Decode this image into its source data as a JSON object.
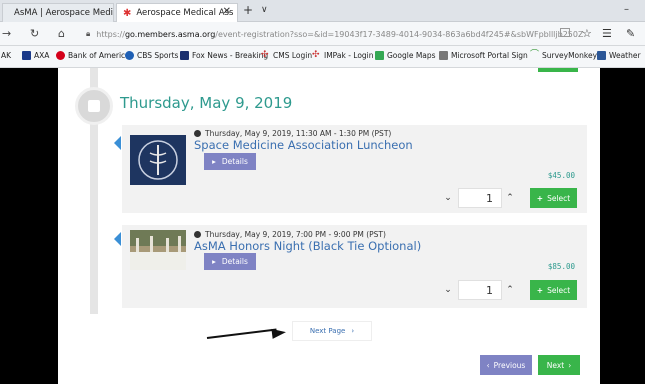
{
  "browser": {
    "tabs": [
      {
        "label": "AsMA | Aerospace Medical"
      },
      {
        "label": "Aerospace Medical Ass"
      }
    ],
    "url_prefix": "https://",
    "url_domain": "go.members.asma.org",
    "url_path": "/event-registration?sso=&id=19043f17-3489-4014-9034-863a6bd4f245#&sbWFpbllljb250ZW50IGN0bDA",
    "favorites": [
      "AK",
      "AXA",
      "Bank of America",
      "CBS Sports",
      "Fox News - Breaking",
      "CMS Login",
      "IMPak - Login",
      "Google Maps",
      "Microsoft Portal Sign",
      "SurveyMonkey",
      "Weather"
    ]
  },
  "day": {
    "title": "Thursday, May 9, 2019"
  },
  "events": [
    {
      "time": "Thursday, May 9, 2019, 11:30 AM - 1:30 PM (PST)",
      "name": "Space Medicine Association Luncheon",
      "details_label": "Details",
      "price": "$45.00",
      "qty": "1",
      "select_label": "Select"
    },
    {
      "time": "Thursday, May 9, 2019, 7:00 PM - 9:00 PM (PST)",
      "name": "AsMA Honors Night (Black Tie Optional)",
      "details_label": "Details",
      "price": "$85.00",
      "qty": "1",
      "select_label": "Select"
    }
  ],
  "pagination": {
    "next_page_label": "Next Page",
    "previous_label": "Previous",
    "next_label": "Next"
  },
  "colors": {
    "accent_teal": "#2e9a8e",
    "link_blue": "#3a6fb0",
    "button_purple": "#7f83c4",
    "button_green": "#39b54a"
  }
}
